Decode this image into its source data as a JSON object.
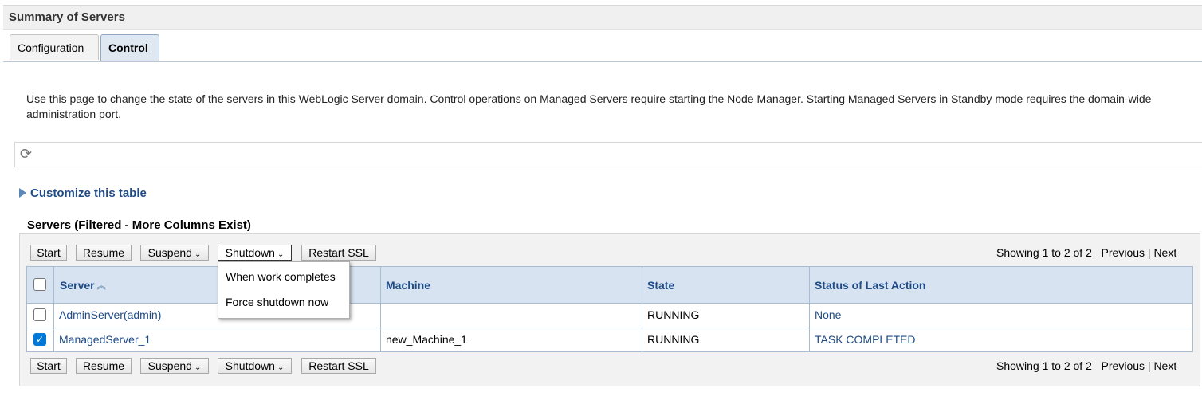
{
  "header": {
    "title": "Summary of Servers"
  },
  "tabs": [
    {
      "label": "Configuration"
    },
    {
      "label": "Control"
    }
  ],
  "description": "Use this page to change the state of the servers in this WebLogic Server domain. Control operations on Managed Servers require starting the Node Manager. Starting Managed Servers in Standby mode requires the domain-wide administration port.",
  "refresh": {
    "icon": "refresh-icon"
  },
  "customize": {
    "label": "Customize this table"
  },
  "table": {
    "title": "Servers (Filtered - More Columns Exist)",
    "toolbar": {
      "start": "Start",
      "resume": "Resume",
      "suspend": "Suspend",
      "shutdown": "Shutdown",
      "restart_ssl": "Restart SSL"
    },
    "pagination": {
      "showing": "Showing 1 to 2 of 2",
      "previous": "Previous",
      "separator": "|",
      "next": "Next"
    },
    "columns": [
      "Server",
      "Machine",
      "State",
      "Status of Last Action"
    ],
    "rows": [
      {
        "server": "AdminServer(admin)",
        "machine": "",
        "state": "RUNNING",
        "status": "None",
        "checked": false
      },
      {
        "server": "ManagedServer_1",
        "machine": "new_Machine_1",
        "state": "RUNNING",
        "status": "TASK COMPLETED",
        "checked": true
      }
    ]
  },
  "shutdown_menu": {
    "items": [
      "When work completes",
      "Force shutdown now"
    ]
  }
}
